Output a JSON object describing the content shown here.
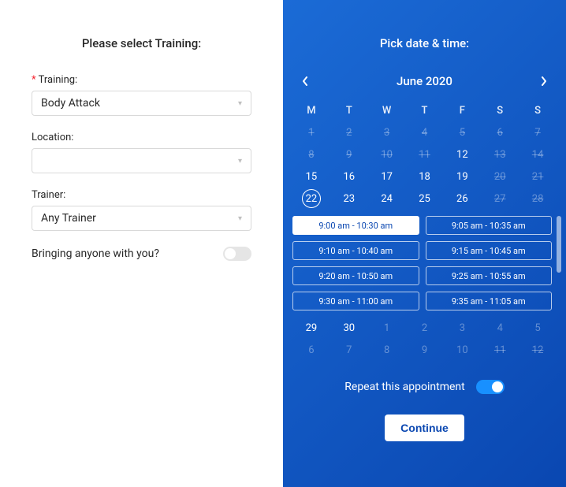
{
  "left": {
    "title": "Please select Training:",
    "training_label": "Training:",
    "training_value": "Body Attack",
    "location_label": "Location:",
    "location_value": "",
    "trainer_label": "Trainer:",
    "trainer_value": "Any Trainer",
    "bring_label": "Bringing anyone with you?",
    "bring_on": false
  },
  "right": {
    "title": "Pick date & time:",
    "month_label": "June 2020",
    "weekday_heads": [
      "M",
      "T",
      "W",
      "T",
      "F",
      "S",
      "S"
    ],
    "weeks": [
      [
        {
          "n": "1",
          "state": "disabled"
        },
        {
          "n": "2",
          "state": "disabled"
        },
        {
          "n": "3",
          "state": "disabled"
        },
        {
          "n": "4",
          "state": "disabled"
        },
        {
          "n": "5",
          "state": "disabled"
        },
        {
          "n": "6",
          "state": "disabled"
        },
        {
          "n": "7",
          "state": "disabled"
        }
      ],
      [
        {
          "n": "8",
          "state": "disabled"
        },
        {
          "n": "9",
          "state": "disabled"
        },
        {
          "n": "10",
          "state": "disabled"
        },
        {
          "n": "11",
          "state": "disabled"
        },
        {
          "n": "12",
          "state": "active"
        },
        {
          "n": "13",
          "state": "disabled"
        },
        {
          "n": "14",
          "state": "disabled"
        }
      ],
      [
        {
          "n": "15",
          "state": "active"
        },
        {
          "n": "16",
          "state": "active"
        },
        {
          "n": "17",
          "state": "active"
        },
        {
          "n": "18",
          "state": "active"
        },
        {
          "n": "19",
          "state": "active"
        },
        {
          "n": "20",
          "state": "disabled"
        },
        {
          "n": "21",
          "state": "disabled"
        }
      ],
      [
        {
          "n": "22",
          "state": "selected"
        },
        {
          "n": "23",
          "state": "active"
        },
        {
          "n": "24",
          "state": "active"
        },
        {
          "n": "25",
          "state": "active"
        },
        {
          "n": "26",
          "state": "active"
        },
        {
          "n": "27",
          "state": "disabled"
        },
        {
          "n": "28",
          "state": "disabled"
        }
      ],
      [
        {
          "n": "29",
          "state": "active"
        },
        {
          "n": "30",
          "state": "active"
        },
        {
          "n": "1",
          "state": "other"
        },
        {
          "n": "2",
          "state": "other"
        },
        {
          "n": "3",
          "state": "other"
        },
        {
          "n": "4",
          "state": "other"
        },
        {
          "n": "5",
          "state": "other"
        }
      ],
      [
        {
          "n": "6",
          "state": "other"
        },
        {
          "n": "7",
          "state": "other"
        },
        {
          "n": "8",
          "state": "other"
        },
        {
          "n": "9",
          "state": "other"
        },
        {
          "n": "10",
          "state": "other"
        },
        {
          "n": "11",
          "state": "disabled"
        },
        {
          "n": "12",
          "state": "disabled"
        }
      ]
    ],
    "slots": [
      {
        "label": "9:00 am - 10:30 am",
        "selected": true
      },
      {
        "label": "9:05 am - 10:35 am",
        "selected": false
      },
      {
        "label": "9:10 am - 10:40 am",
        "selected": false
      },
      {
        "label": "9:15 am - 10:45 am",
        "selected": false
      },
      {
        "label": "9:20 am - 10:50 am",
        "selected": false
      },
      {
        "label": "9:25 am - 10:55 am",
        "selected": false
      },
      {
        "label": "9:30 am - 11:00 am",
        "selected": false
      },
      {
        "label": "9:35 am - 11:05 am",
        "selected": false
      }
    ],
    "repeat_label": "Repeat this appointment",
    "repeat_on": true,
    "continue_label": "Continue"
  }
}
